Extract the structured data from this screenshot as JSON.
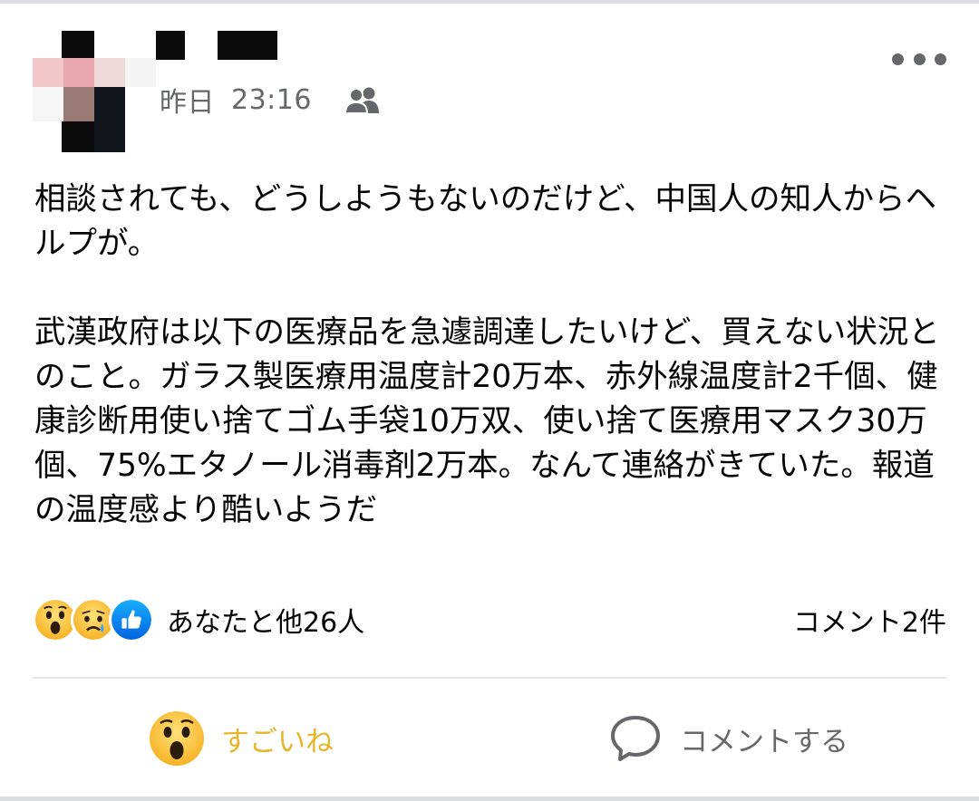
{
  "colors": {
    "text_primary": "#050505",
    "text_secondary": "#65676b",
    "wow_label": "#e8b52a",
    "like_blue": "#1877f2",
    "divider": "#e4e6eb"
  },
  "post": {
    "timestamp_day": "昨日",
    "timestamp_time": "23:16",
    "audience_icon": "friends-icon",
    "more_icon": "more-horizontal-icon",
    "paragraphs": [
      "相談されても、どうしようもないのだけど、中国人の知人からヘルプが。",
      "武漢政府は以下の医療品を急遽調達したいけど、買えない状況とのこと。ガラス製医療用温度計20万本、赤外線温度計2千個、健康診断用使い捨てゴム手袋10万双、使い捨て医療用マスク30万個、75%エタノール消毒剤2万本。なんて連絡がきていた。報道の温度感より酷いようだ"
    ]
  },
  "reactions": {
    "icons": [
      "wow-reaction-icon",
      "sad-reaction-icon",
      "like-reaction-icon"
    ],
    "summary": "あなたと他26人",
    "comments": "コメント2件"
  },
  "actions": {
    "reaction_label": "すごいね",
    "reaction_icon": "wow-reaction-icon",
    "comment_label": "コメントする",
    "comment_icon": "comment-bubble-icon"
  }
}
